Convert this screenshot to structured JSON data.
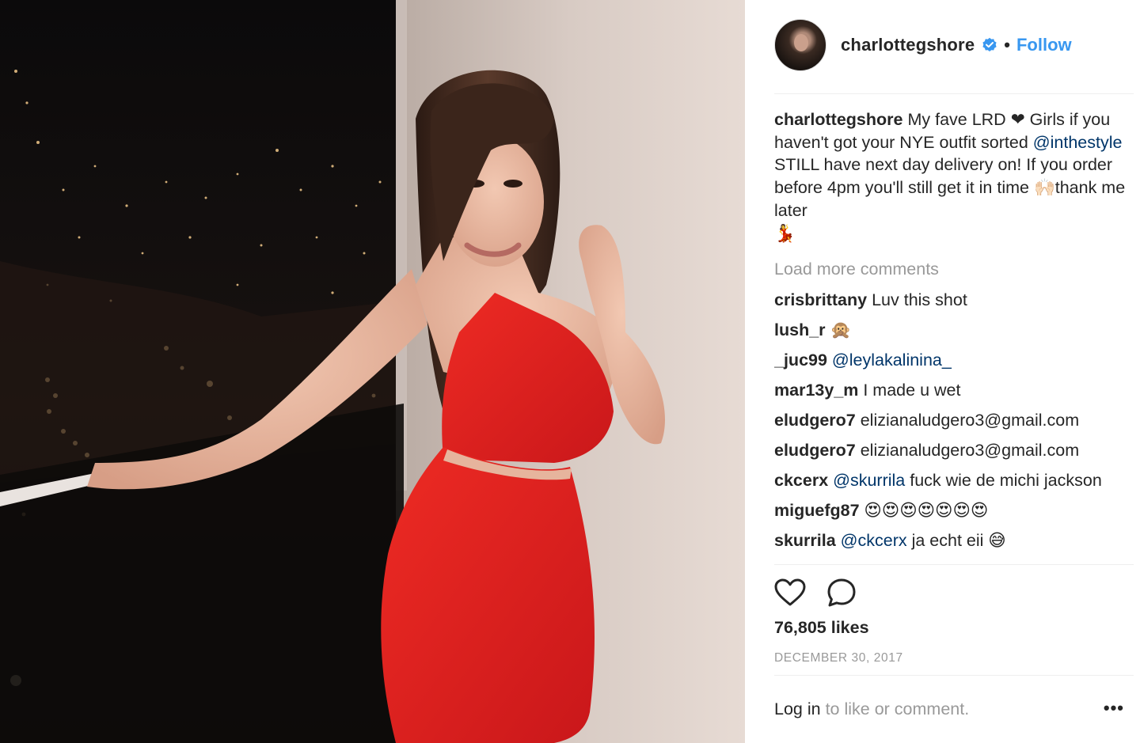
{
  "post": {
    "image_description": "",
    "header": {
      "username": "charlottegshore",
      "separator": "•",
      "follow_label": "Follow"
    },
    "caption": {
      "username": "charlottegshore",
      "text_1": " My fave LRD ",
      "heart": "❤",
      "text_2": " Girls if you haven't got your NYE outfit sorted ",
      "mention": "@inthestyle",
      "text_3": " STILL have next day delivery on! If you order before 4pm you'll still get it in time ",
      "hands_emoji": "🙌🏻",
      "text_4": "thank me later",
      "dancer_emoji": "💃"
    },
    "load_more_label": "Load more comments",
    "comments": [
      {
        "user": "crisbrittany",
        "text": " Luv this shot",
        "mention": ""
      },
      {
        "user": "lush_r",
        "text": " 🙊",
        "mention": ""
      },
      {
        "user": "_juc99",
        "text": "",
        "mention": " @leylakalinina_"
      },
      {
        "user": "mar13y_m",
        "text": " I made u wet",
        "mention": ""
      },
      {
        "user": "eludgero7",
        "text": " elizianaludgero3@gmail.com",
        "mention": ""
      },
      {
        "user": "eludgero7",
        "text": " elizianaludgero3@gmail.com",
        "mention": ""
      },
      {
        "user": "ckcerx",
        "text": " fuck wie de michi jackson",
        "mention": " @skurrila"
      },
      {
        "user": "miguefg87",
        "text": " 😍😍😍😍😍😍😍",
        "mention": ""
      },
      {
        "user": "skurrila",
        "text": " ja echt eii 😅",
        "mention": " @ckcerx"
      }
    ],
    "likes": "76,805 likes",
    "date": "DECEMBER 30, 2017",
    "login": {
      "link": "Log in",
      "rest": " to like or comment.",
      "more": "•••"
    },
    "icons": {
      "like": "heart-icon",
      "comment": "comment-icon",
      "verified": "verified-badge-icon"
    },
    "colors": {
      "link_blue": "#3897f0",
      "mention_blue": "#003569",
      "muted": "#999999",
      "text": "#262626",
      "dress_red": "#e0231f"
    }
  }
}
